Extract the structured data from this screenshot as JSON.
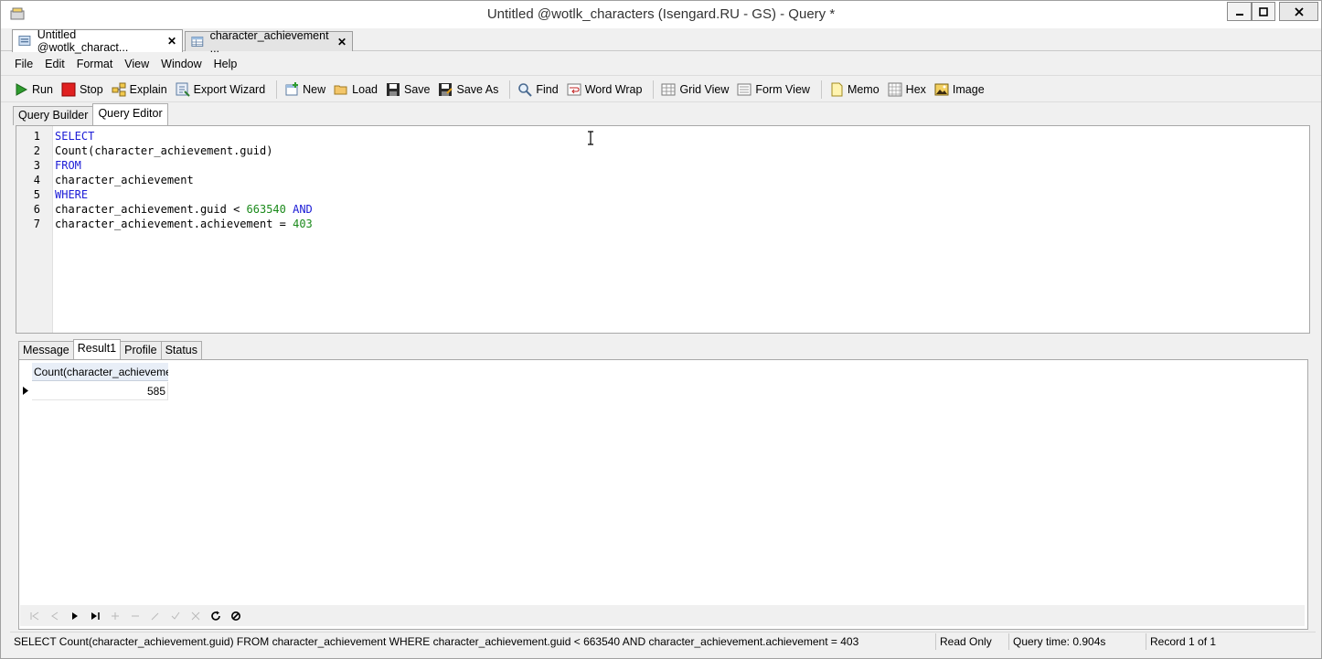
{
  "window": {
    "title": "Untitled @wotlk_characters (Isengard.RU - GS) - Query *"
  },
  "doc_tabs": [
    {
      "label": "Untitled @wotlk_charact...",
      "active": true
    },
    {
      "label": "character_achievement ...",
      "active": false
    }
  ],
  "menu": [
    "File",
    "Edit",
    "Format",
    "View",
    "Window",
    "Help"
  ],
  "toolbar": {
    "run": "Run",
    "stop": "Stop",
    "explain": "Explain",
    "export_wizard": "Export Wizard",
    "new": "New",
    "load": "Load",
    "save": "Save",
    "save_as": "Save As",
    "find": "Find",
    "word_wrap": "Word Wrap",
    "grid_view": "Grid View",
    "form_view": "Form View",
    "memo": "Memo",
    "hex": "Hex",
    "image": "Image"
  },
  "sub_tabs": [
    "Query Builder",
    "Query Editor"
  ],
  "editor": {
    "lines": [
      {
        "n": "1",
        "parts": [
          {
            "t": "SELECT",
            "c": "kw"
          }
        ]
      },
      {
        "n": "2",
        "parts": [
          {
            "t": "Count(character_achievement.guid)",
            "c": ""
          }
        ]
      },
      {
        "n": "3",
        "parts": [
          {
            "t": "FROM",
            "c": "kw"
          }
        ]
      },
      {
        "n": "4",
        "parts": [
          {
            "t": "character_achievement",
            "c": ""
          }
        ]
      },
      {
        "n": "5",
        "parts": [
          {
            "t": "WHERE",
            "c": "kw"
          }
        ]
      },
      {
        "n": "6",
        "parts": [
          {
            "t": "character_achievement.guid < ",
            "c": ""
          },
          {
            "t": "663540",
            "c": "num"
          },
          {
            "t": " ",
            "c": ""
          },
          {
            "t": "AND",
            "c": "kw"
          }
        ]
      },
      {
        "n": "7",
        "parts": [
          {
            "t": "character_achievement.achievement = ",
            "c": ""
          },
          {
            "t": "403",
            "c": "num"
          }
        ]
      }
    ]
  },
  "result_tabs": [
    "Message",
    "Result1",
    "Profile",
    "Status"
  ],
  "grid": {
    "column_header": "Count(character_achieveme",
    "rows": [
      "585"
    ]
  },
  "status": {
    "sql": "SELECT Count(character_achievement.guid) FROM character_achievement WHERE character_achievement.guid < 663540 AND character_achievement.achievement = 403",
    "read_only": "Read Only",
    "query_time": "Query time: 0.904s",
    "record": "Record 1 of 1"
  }
}
